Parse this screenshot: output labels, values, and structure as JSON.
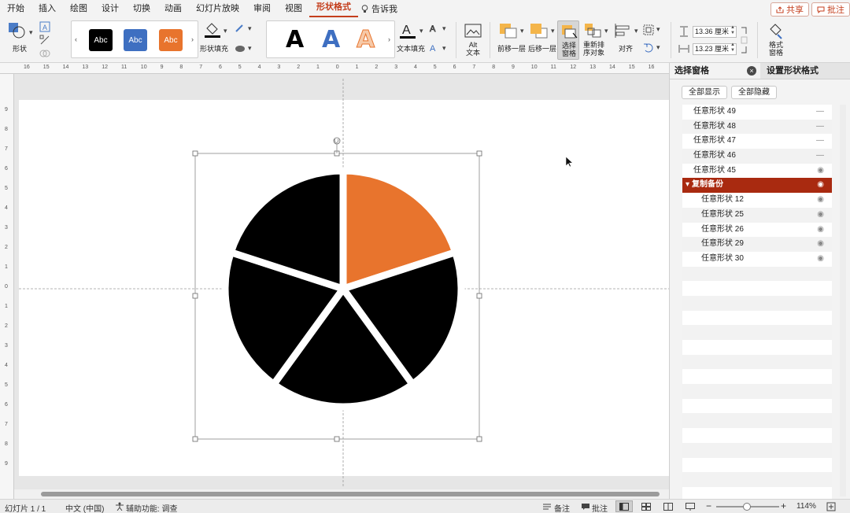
{
  "tabs": [
    {
      "label": "开始",
      "active": false
    },
    {
      "label": "插入",
      "active": false
    },
    {
      "label": "绘图",
      "active": false
    },
    {
      "label": "设计",
      "active": false
    },
    {
      "label": "切换",
      "active": false
    },
    {
      "label": "动画",
      "active": false
    },
    {
      "label": "幻灯片放映",
      "active": false
    },
    {
      "label": "审阅",
      "active": false
    },
    {
      "label": "视图",
      "active": false
    },
    {
      "label": "形状格式",
      "active": true
    }
  ],
  "tell_me": "告诉我",
  "share_label": "共享",
  "comment_label": "批注",
  "ribbon": {
    "shape_label": "形状",
    "style_samples": [
      "Abc",
      "Abc",
      "Abc"
    ],
    "style_colors": [
      "#000000",
      "#3e6fc1",
      "#e8742d"
    ],
    "shape_fill_label": "形状填充",
    "wordart_samples": [
      "A",
      "A",
      "A"
    ],
    "text_fill_label": "文本填充",
    "alt_text_label": [
      "Alt",
      "文本"
    ],
    "bring_forward_label": "前移一层",
    "send_backward_label": "后移一层",
    "selection_pane_label": [
      "选择",
      "窗格"
    ],
    "reorder_label": [
      "重新排",
      "序对象"
    ],
    "align_label": "对齐",
    "height_value": "13.36 厘米",
    "width_value": "13.23 厘米",
    "format_pane_label": [
      "格式",
      "窗格"
    ]
  },
  "ruler_h": [
    "16",
    "15",
    "14",
    "13",
    "12",
    "11",
    "10",
    "9",
    "8",
    "7",
    "6",
    "5",
    "4",
    "3",
    "2",
    "1",
    "0",
    "1",
    "2",
    "3",
    "4",
    "5",
    "6",
    "7",
    "8",
    "9",
    "10",
    "11",
    "12",
    "13",
    "14",
    "15",
    "16"
  ],
  "ruler_v": [
    "9",
    "8",
    "7",
    "6",
    "5",
    "4",
    "3",
    "2",
    "1",
    "0",
    "1",
    "2",
    "3",
    "4",
    "5",
    "6",
    "7",
    "8",
    "9"
  ],
  "chart_data": {
    "type": "pie",
    "slices": [
      {
        "value": 20,
        "color": "#e8742d"
      },
      {
        "value": 20,
        "color": "#000000"
      },
      {
        "value": 20,
        "color": "#000000"
      },
      {
        "value": 20,
        "color": "#000000"
      },
      {
        "value": 20,
        "color": "#000000"
      }
    ],
    "gap_color": "#ffffff"
  },
  "pane": {
    "tab_selection": "选择窗格",
    "tab_format": "设置形状格式",
    "show_all": "全部显示",
    "hide_all": "全部隐藏",
    "items": [
      {
        "label": "任意形状 49",
        "level": 0,
        "selected": false,
        "visible": false
      },
      {
        "label": "任意形状 48",
        "level": 0,
        "selected": false,
        "visible": false
      },
      {
        "label": "任意形状 47",
        "level": 0,
        "selected": false,
        "visible": false
      },
      {
        "label": "任意形状 46",
        "level": 0,
        "selected": false,
        "visible": false
      },
      {
        "label": "任意形状 45",
        "level": 0,
        "selected": false,
        "visible": true
      },
      {
        "label": "复制备份",
        "level": 0,
        "selected": true,
        "visible": true
      },
      {
        "label": "任意形状 12",
        "level": 1,
        "selected": false,
        "visible": true
      },
      {
        "label": "任意形状 25",
        "level": 1,
        "selected": false,
        "visible": true
      },
      {
        "label": "任意形状 26",
        "level": 1,
        "selected": false,
        "visible": true
      },
      {
        "label": "任意形状 29",
        "level": 1,
        "selected": false,
        "visible": true
      },
      {
        "label": "任意形状 30",
        "level": 1,
        "selected": false,
        "visible": true
      }
    ]
  },
  "status": {
    "slide_info": "幻灯片 1 / 1",
    "language": "中文 (中国)",
    "accessibility": "辅助功能: 调查",
    "notes": "备注",
    "comments": "批注",
    "zoom": "114%"
  },
  "colors": {
    "accent": "#c43e1c",
    "selected_row": "#a92a10",
    "orange": "#e8742d"
  }
}
